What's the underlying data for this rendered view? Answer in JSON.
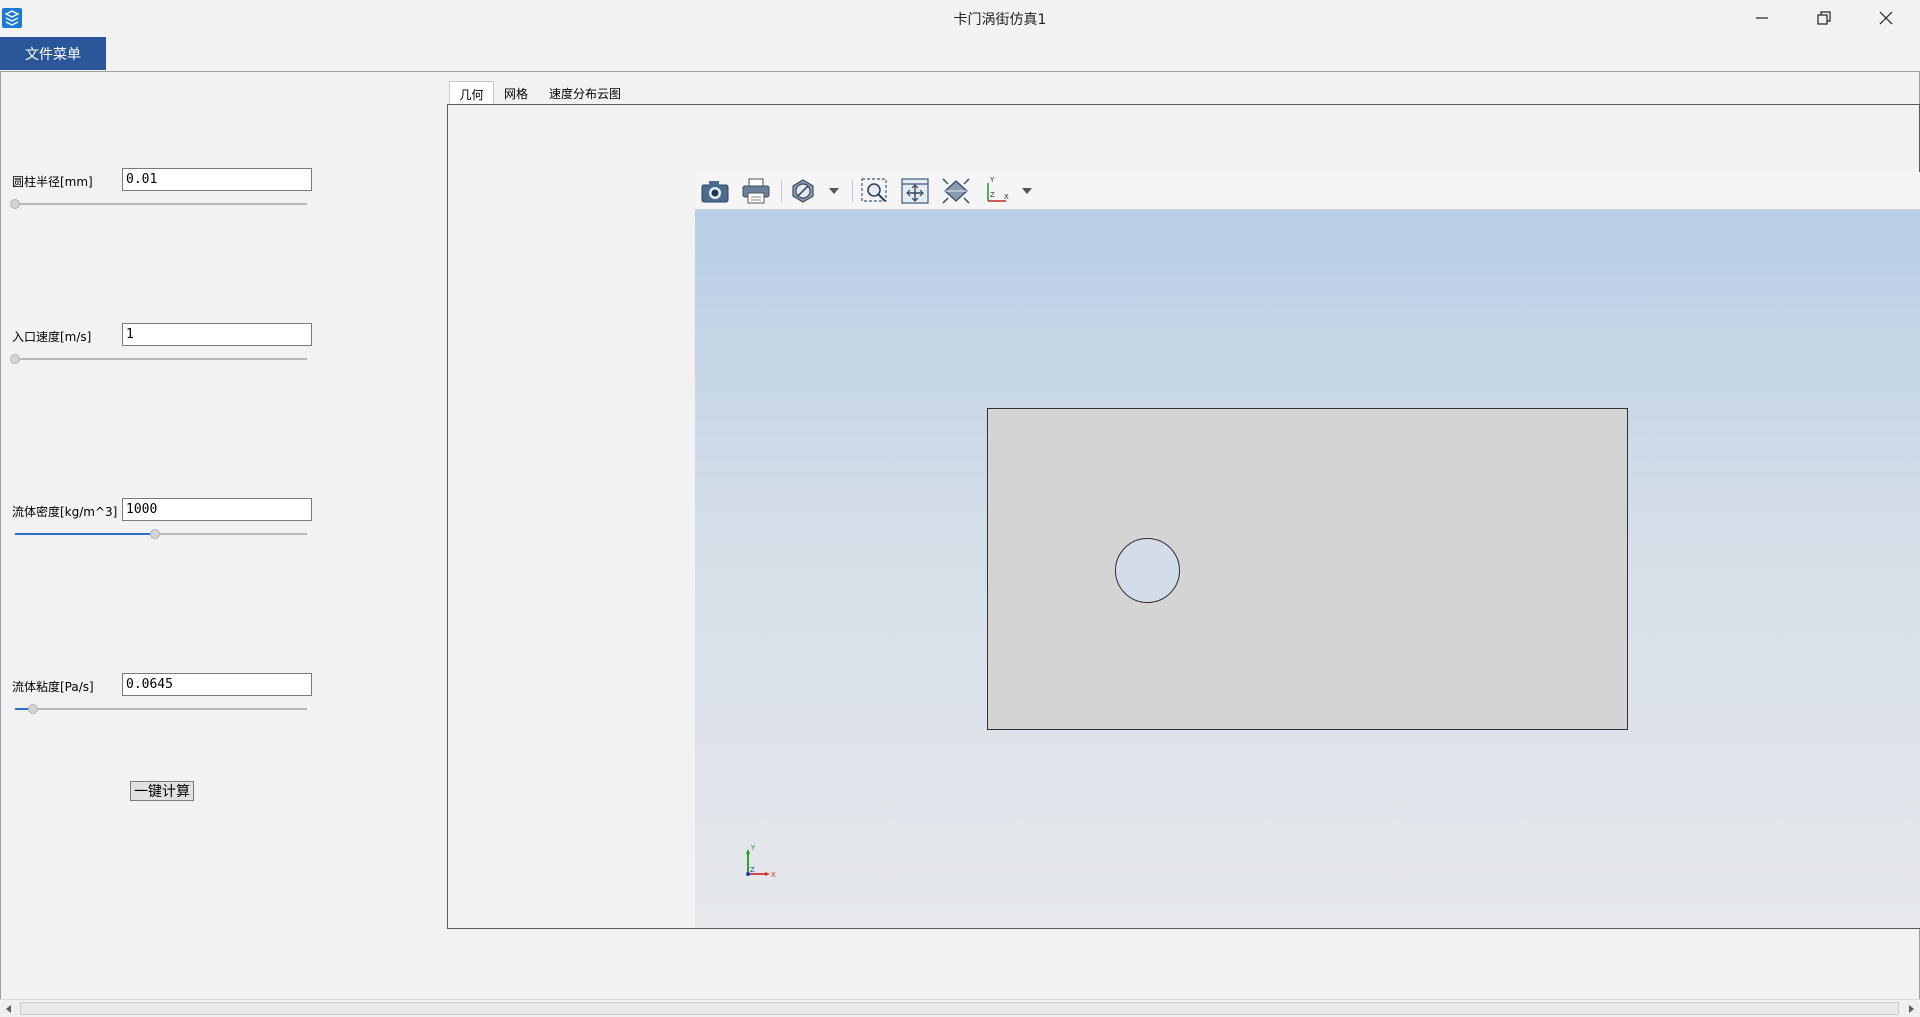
{
  "window": {
    "title": "卡门涡街仿真1",
    "controls": [
      "minimize",
      "restore",
      "close"
    ]
  },
  "menu": {
    "file_label": "文件菜单"
  },
  "params": [
    {
      "label": "圆柱半径[mm]",
      "value": "0.01",
      "slider_fraction": 0.0
    },
    {
      "label": "入口速度[m/s]",
      "value": "1",
      "slider_fraction": 0.0
    },
    {
      "label": "流体密度[kg/m^3]",
      "value": "1000",
      "slider_fraction": 0.48
    },
    {
      "label": "流体粘度[Pa/s]",
      "value": "0.0645",
      "slider_fraction": 0.06
    }
  ],
  "calc_button": "一键计算",
  "tabs": [
    {
      "label": "几何",
      "active": true
    },
    {
      "label": "网格",
      "active": false
    },
    {
      "label": "速度分布云图",
      "active": false
    }
  ],
  "viewer": {
    "toolbar_icons": [
      "camera-icon",
      "print-icon",
      "display-mode-icon",
      "zoom-box-icon",
      "fit-all-icon",
      "iso-view-icon",
      "axis-view-icon"
    ],
    "axis_labels": {
      "x": "X",
      "y": "Y",
      "z": "Z"
    }
  },
  "colors": {
    "menu_accent": "#2b579a",
    "slider_fill": "#2a6fd1",
    "viewport_top": "#b9cfe5",
    "viewport_bottom": "#e6e8ec",
    "domain_fill": "#d4d4d4"
  }
}
